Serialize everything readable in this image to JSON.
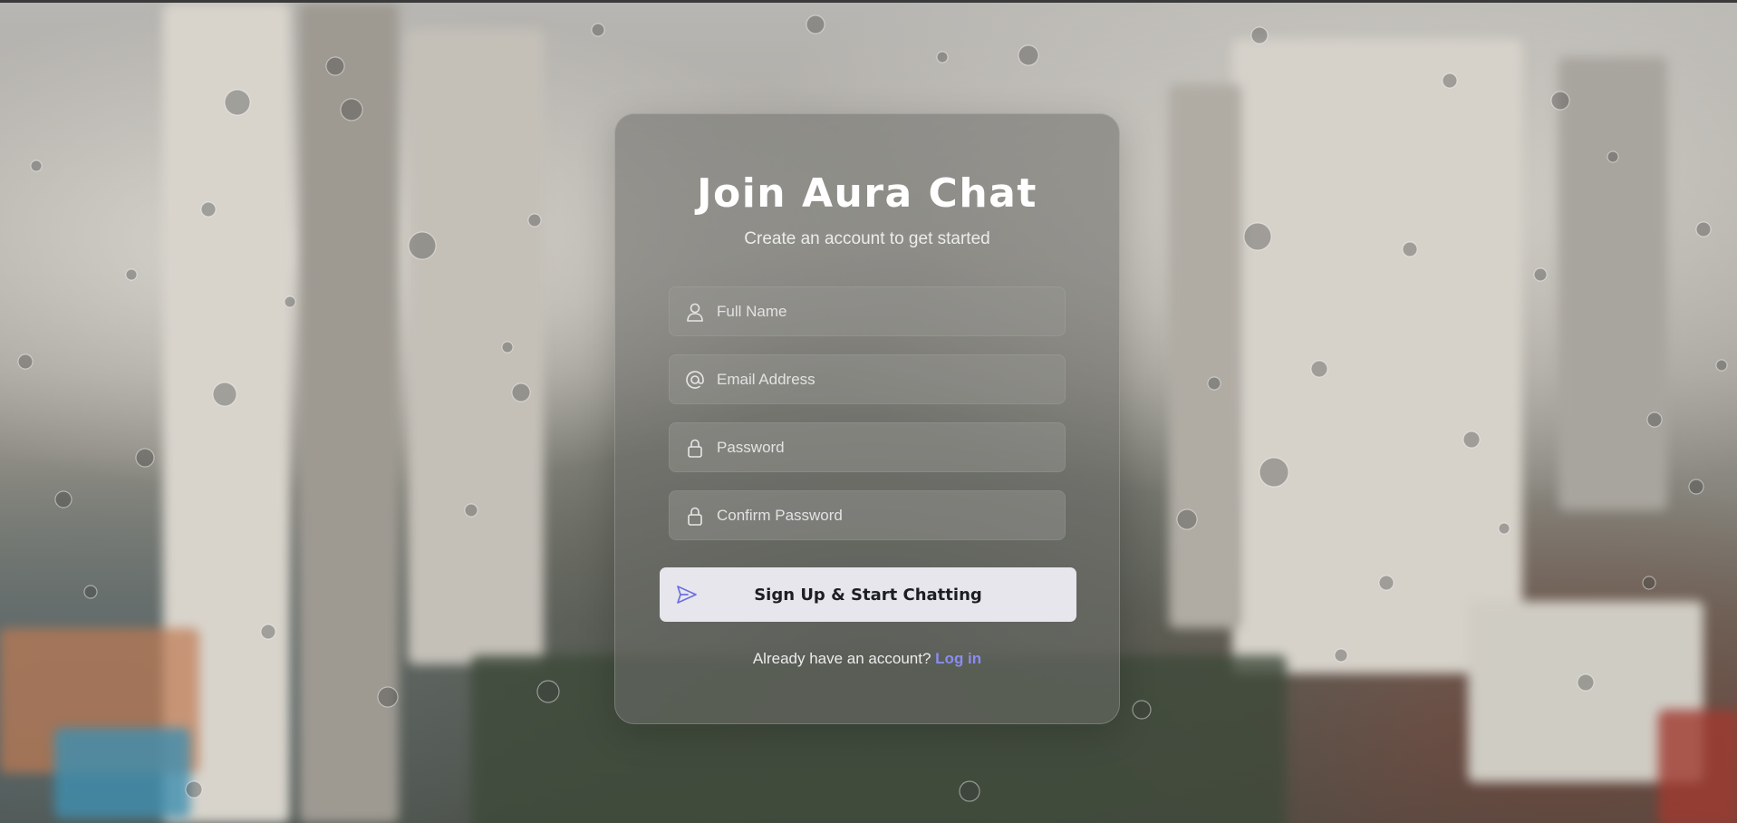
{
  "signup": {
    "title": "Join Aura Chat",
    "subtitle": "Create an account to get started",
    "fields": {
      "full_name": {
        "placeholder": "Full Name",
        "icon": "user-icon"
      },
      "email": {
        "placeholder": "Email Address",
        "icon": "at-icon"
      },
      "password": {
        "placeholder": "Password",
        "icon": "lock-icon"
      },
      "confirm_password": {
        "placeholder": "Confirm Password",
        "icon": "lock-icon"
      }
    },
    "submit_label": "Sign Up & Start Chatting",
    "submit_icon": "send-icon",
    "login_prompt": "Already have an account?",
    "login_link": "Log in"
  },
  "colors": {
    "accent": "#8a8cf0",
    "button_bg": "#e6e6ec",
    "button_text": "#1d1d24",
    "send_icon": "#6b6fe0"
  }
}
